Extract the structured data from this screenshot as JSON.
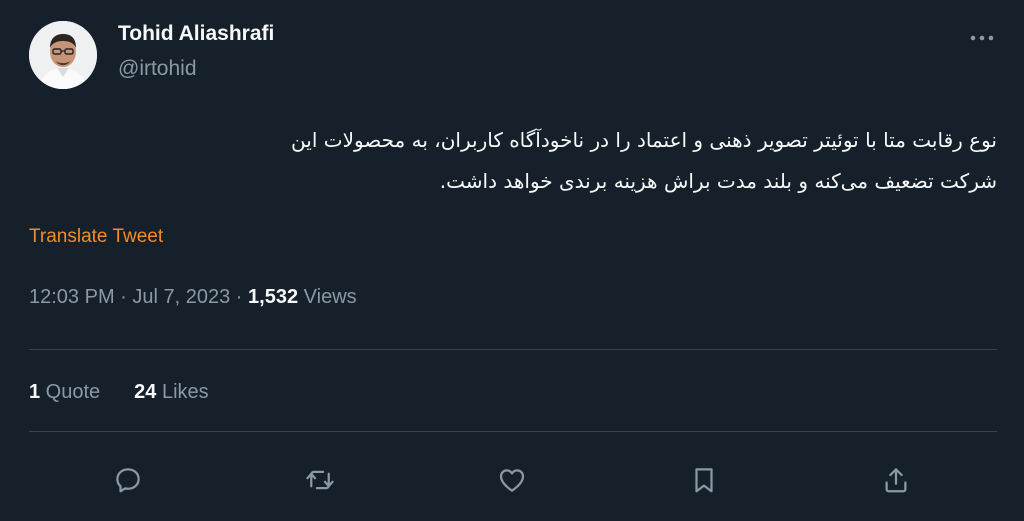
{
  "author": {
    "name": "Tohid Aliashrafi",
    "handle": "@irtohid"
  },
  "tweet": {
    "line1": "نوع رقابت متا با توئیتر تصویر ذهنی و اعتماد را در ناخودآگاه کاربران، به محصولات این",
    "line2": "شرکت تضعیف می‌کنه و بلند مدت براش هزینه برندی  خواهد داشت."
  },
  "translate_label": "Translate Tweet",
  "meta": {
    "time": "12:03 PM",
    "separator1": " · ",
    "date": "Jul 7, 2023",
    "separator2": " · ",
    "views_count": "1,532",
    "views_label": " Views"
  },
  "stats": {
    "quotes_count": "1",
    "quotes_label": " Quote",
    "likes_count": "24",
    "likes_label": " Likes"
  },
  "icons": {
    "more": "more-horizontal-icon",
    "reply": "reply-icon",
    "retweet": "retweet-icon",
    "like": "like-icon",
    "bookmark": "bookmark-icon",
    "share": "share-icon"
  },
  "colors": {
    "background": "#15202b",
    "text": "#f7f9f9",
    "secondary": "#8b98a5",
    "translate": "#f28c28",
    "divider": "#38444d"
  }
}
